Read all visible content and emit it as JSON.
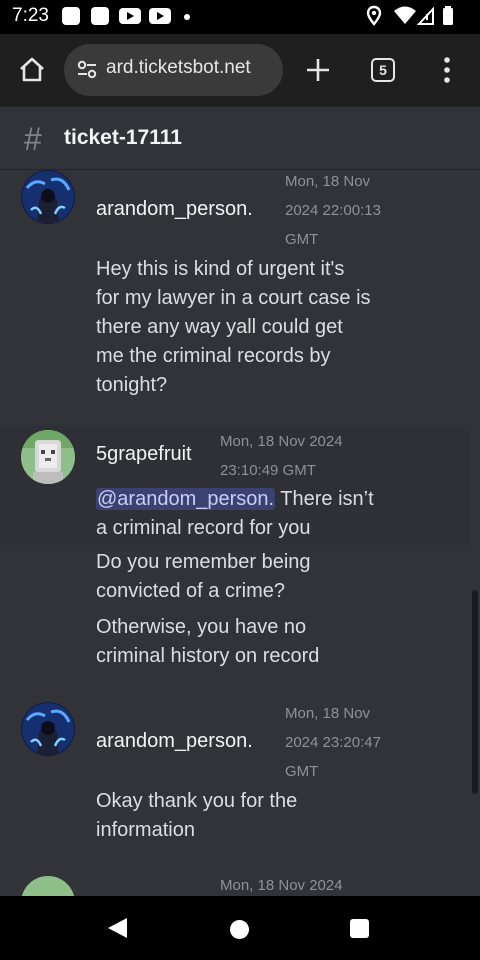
{
  "status_bar": {
    "time": "7:23"
  },
  "browser": {
    "url": "ard.ticketsbot.net",
    "tab_count": "5"
  },
  "channel": {
    "name": "ticket-17111"
  },
  "messages": [
    {
      "author": "arandom_person.",
      "timestamp_lines": [
        "Mon, 18 Nov",
        "2024 22:00:13",
        "GMT"
      ],
      "lines": [
        "Hey this is kind of urgent it's",
        "for my lawyer in a court case is",
        "there any way yall could get",
        "me the criminal records by",
        "tonight?"
      ]
    },
    {
      "author": "5grapefruit",
      "timestamp_lines": [
        "Mon, 18 Nov 2024",
        "23:10:49 GMT"
      ],
      "mention": "@arandom_person.",
      "first_line_rest": " There isn’t",
      "line2": "a criminal record for you",
      "follow_ups": [
        [
          "Do you remember being",
          "convicted of a crime?"
        ],
        [
          "Otherwise, you have no",
          "criminal history on record"
        ]
      ]
    },
    {
      "author": "arandom_person.",
      "timestamp_lines": [
        "Mon, 18 Nov",
        "2024 23:20:47",
        "GMT"
      ],
      "lines": [
        "Okay thank you for the",
        "information"
      ]
    },
    {
      "timestamp_partial": "Mon, 18 Nov 2024"
    }
  ]
}
